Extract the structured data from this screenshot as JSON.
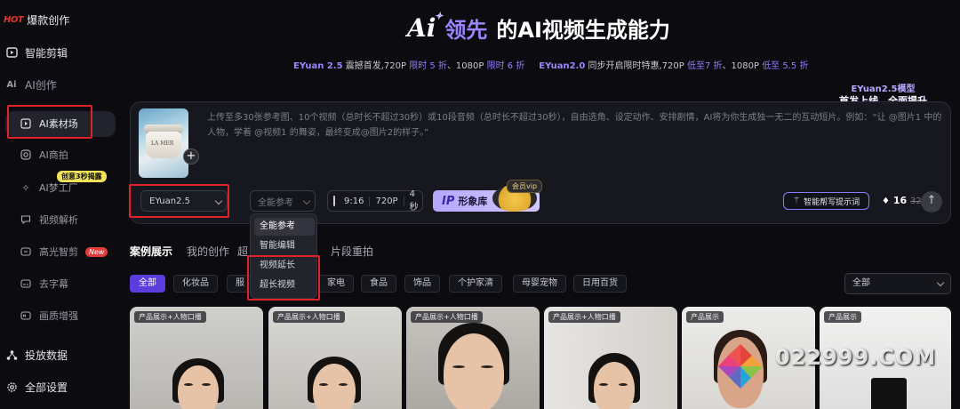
{
  "brand": {
    "mark": "HOT",
    "name": "爆款创作"
  },
  "sidebar": {
    "items": [
      {
        "label": "智能剪辑"
      },
      {
        "label": "AI创作"
      },
      {
        "label": "AI素材场"
      },
      {
        "label": "AI商拍"
      },
      {
        "label": "AI梦工厂",
        "badge": "创意3秒揭露"
      },
      {
        "label": "视频解析"
      },
      {
        "label": "高光智剪",
        "badge": "New"
      },
      {
        "label": "去字幕"
      },
      {
        "label": "画质增强"
      },
      {
        "label": "投放数据"
      },
      {
        "label": "全部设置"
      }
    ]
  },
  "hero": {
    "ai_mark": "Ai",
    "lead": "领先",
    "rest": "的AI视频生成能力",
    "sub_a_name": "EYuan 2.5",
    "sub_a_text": "震撼首发,720P",
    "sub_a_p1": "限时 5 折",
    "sub_a_mid": "、1080P",
    "sub_a_p2": "限时 6 折",
    "sub_b_name": "EYuan2.0",
    "sub_b_text": "同步开启限时特惠,720P",
    "sub_b_p1": "低至7 折",
    "sub_b_mid": "、1080P",
    "sub_b_p2": "低至 5.5 折"
  },
  "promo": {
    "line1": "EYuan2.5模型",
    "line2": "首发上线，全面提升"
  },
  "prompt": {
    "product_brand": "LA MER",
    "placeholder": "上传至多30张参考图、10个视频（总时长不超过30秒）或10段音频（总时长不超过30秒），自由选角、设定动作、安排剧情，AI将为你生成独一无二的互动短片。例如：“让 @图片1 中的人物，学着 @视频1 的舞姿，最终变成@图片2的样子。”"
  },
  "controls": {
    "model": "EYuan2.5",
    "ref_mode": "全能参考",
    "ratio": "9:16",
    "resolution": "720P",
    "duration": "4秒",
    "ip_prefix": "IP",
    "ip_label": "形象库",
    "vip_badge": "会员vip",
    "smart_prompt": "智能帮写提示词",
    "credits": "16",
    "credits_old": "32"
  },
  "ref_menu": [
    "全能参考",
    "智能编辑",
    "视频延长",
    "超长视频"
  ],
  "tabs": [
    "案例展示",
    "我的创作",
    "超",
    "片段重拍"
  ],
  "filters": [
    "全部",
    "化妆品",
    "服",
    "家电",
    "食品",
    "饰品",
    "个护家清",
    "母婴宠物",
    "日用百货"
  ],
  "sort": "全部",
  "cards": [
    {
      "tag": "产品展示+人物口播"
    },
    {
      "tag": "产品展示+人物口播"
    },
    {
      "tag": "产品展示+人物口播"
    },
    {
      "tag": "产品展示+人物口播"
    },
    {
      "tag": "产品展示"
    },
    {
      "tag": "产品展示"
    }
  ],
  "watermark": "022999.COM",
  "colors": {
    "accent": "#5b3dde",
    "highlight": "#e0222a",
    "violet": "#9b86ff"
  }
}
